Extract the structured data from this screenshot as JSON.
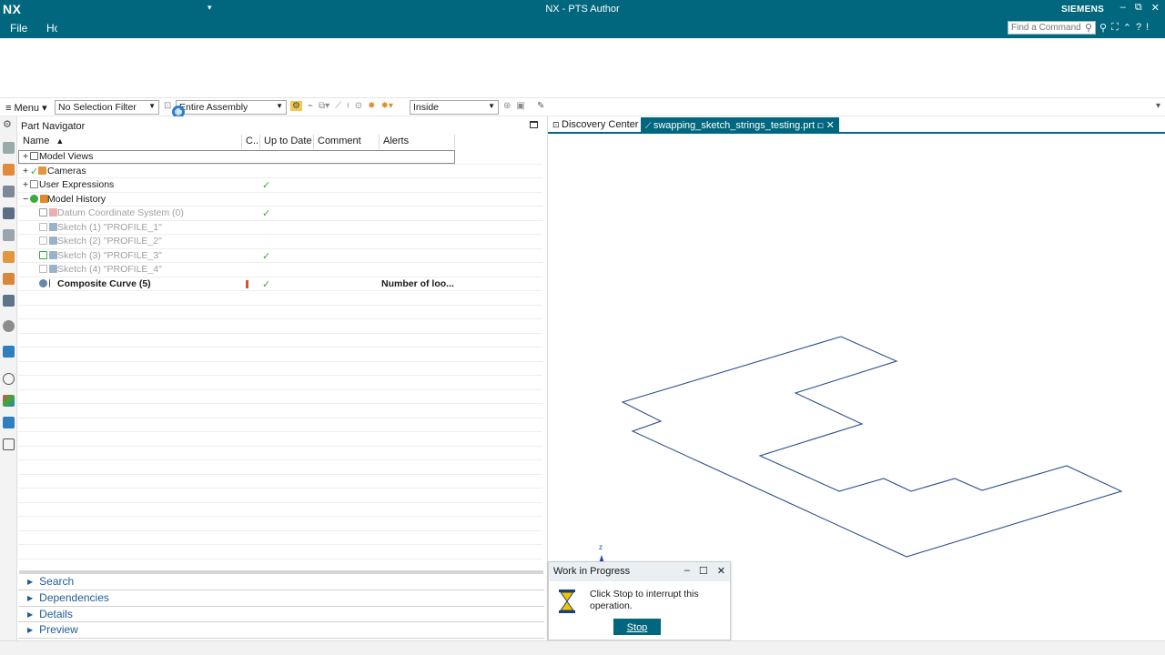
{
  "titlebar": {
    "logo": "NX",
    "app_title": "NX - PTS Author",
    "brand": "SIEMENS",
    "minimize": "–",
    "restore": "⧉",
    "close": "✕"
  },
  "menubar": {
    "file": "File",
    "home": "Home",
    "find_placeholder": "Find a Command"
  },
  "selection_toolbar": {
    "menu_label": "Menu",
    "selection_filter": "No Selection Filter",
    "scope": "Entire Assembly",
    "selection_mode": "Inside"
  },
  "part_navigator": {
    "title": "Part Navigator",
    "columns": [
      "Name",
      "C...",
      "Up to Date",
      "Comment",
      "Alerts"
    ],
    "rows": [
      {
        "expander": "+",
        "icon": "model-views-icon",
        "name": "Model Views",
        "up_to_date": "",
        "alert": ""
      },
      {
        "expander": "+",
        "icon": "cameras-icon",
        "name": "Cameras",
        "up_to_date": "",
        "alert": ""
      },
      {
        "expander": "+",
        "icon": "folder-icon",
        "name": "User Expressions",
        "up_to_date": "✓",
        "alert": ""
      },
      {
        "expander": "−",
        "icon": "model-history-icon",
        "name": "Model History",
        "up_to_date": "",
        "alert": ""
      },
      {
        "expander": "",
        "icon": "datum-csys-icon",
        "name": "Datum Coordinate System (0)",
        "up_to_date": "✓",
        "alert": ""
      },
      {
        "expander": "",
        "icon": "sketch-icon",
        "name": "Sketch (1) \"PROFILE_1\"",
        "up_to_date": "",
        "alert": ""
      },
      {
        "expander": "",
        "icon": "sketch-icon",
        "name": "Sketch (2) \"PROFILE_2\"",
        "up_to_date": "",
        "alert": ""
      },
      {
        "expander": "",
        "icon": "sketch-icon",
        "name": "Sketch (3) \"PROFILE_3\"",
        "up_to_date": "✓",
        "alert": ""
      },
      {
        "expander": "",
        "icon": "sketch-icon",
        "name": "Sketch (4) \"PROFILE_4\"",
        "up_to_date": "",
        "alert": ""
      },
      {
        "expander": "",
        "icon": "composite-curve-icon",
        "name": "Composite Curve (5)",
        "up_to_date": "✓",
        "alert": "Number of loo..."
      }
    ],
    "panels": [
      "Search",
      "Dependencies",
      "Details",
      "Preview"
    ]
  },
  "graphics": {
    "tabs": [
      {
        "label": "Discovery Center"
      },
      {
        "label": "swapping_sketch_strings_testing.prt"
      }
    ],
    "axis_label": "z",
    "curve_color": "#2e4f8f"
  },
  "wip_dialog": {
    "title": "Work in Progress",
    "message": "Click Stop to interrupt this operation.",
    "stop_label": "Stop"
  },
  "colors": {
    "accent": "#00677f",
    "check": "#3aaa3a",
    "link": "#1f5c99"
  }
}
